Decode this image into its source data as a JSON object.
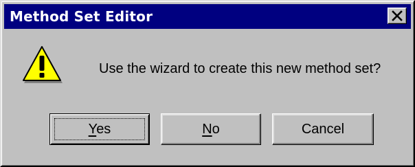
{
  "dialog": {
    "title": "Method Set Editor",
    "close_glyph": "✕",
    "icon": "warning-icon",
    "message": "Use the wizard to create this new method set?",
    "buttons": {
      "yes": {
        "mnemonic": "Y",
        "rest": "es"
      },
      "no": {
        "mnemonic": "N",
        "rest": "o"
      },
      "cancel": {
        "label": "Cancel"
      }
    }
  },
  "colors": {
    "titlebar": "#000080",
    "face": "#c0c0c0",
    "warning_fill": "#ffff00"
  }
}
